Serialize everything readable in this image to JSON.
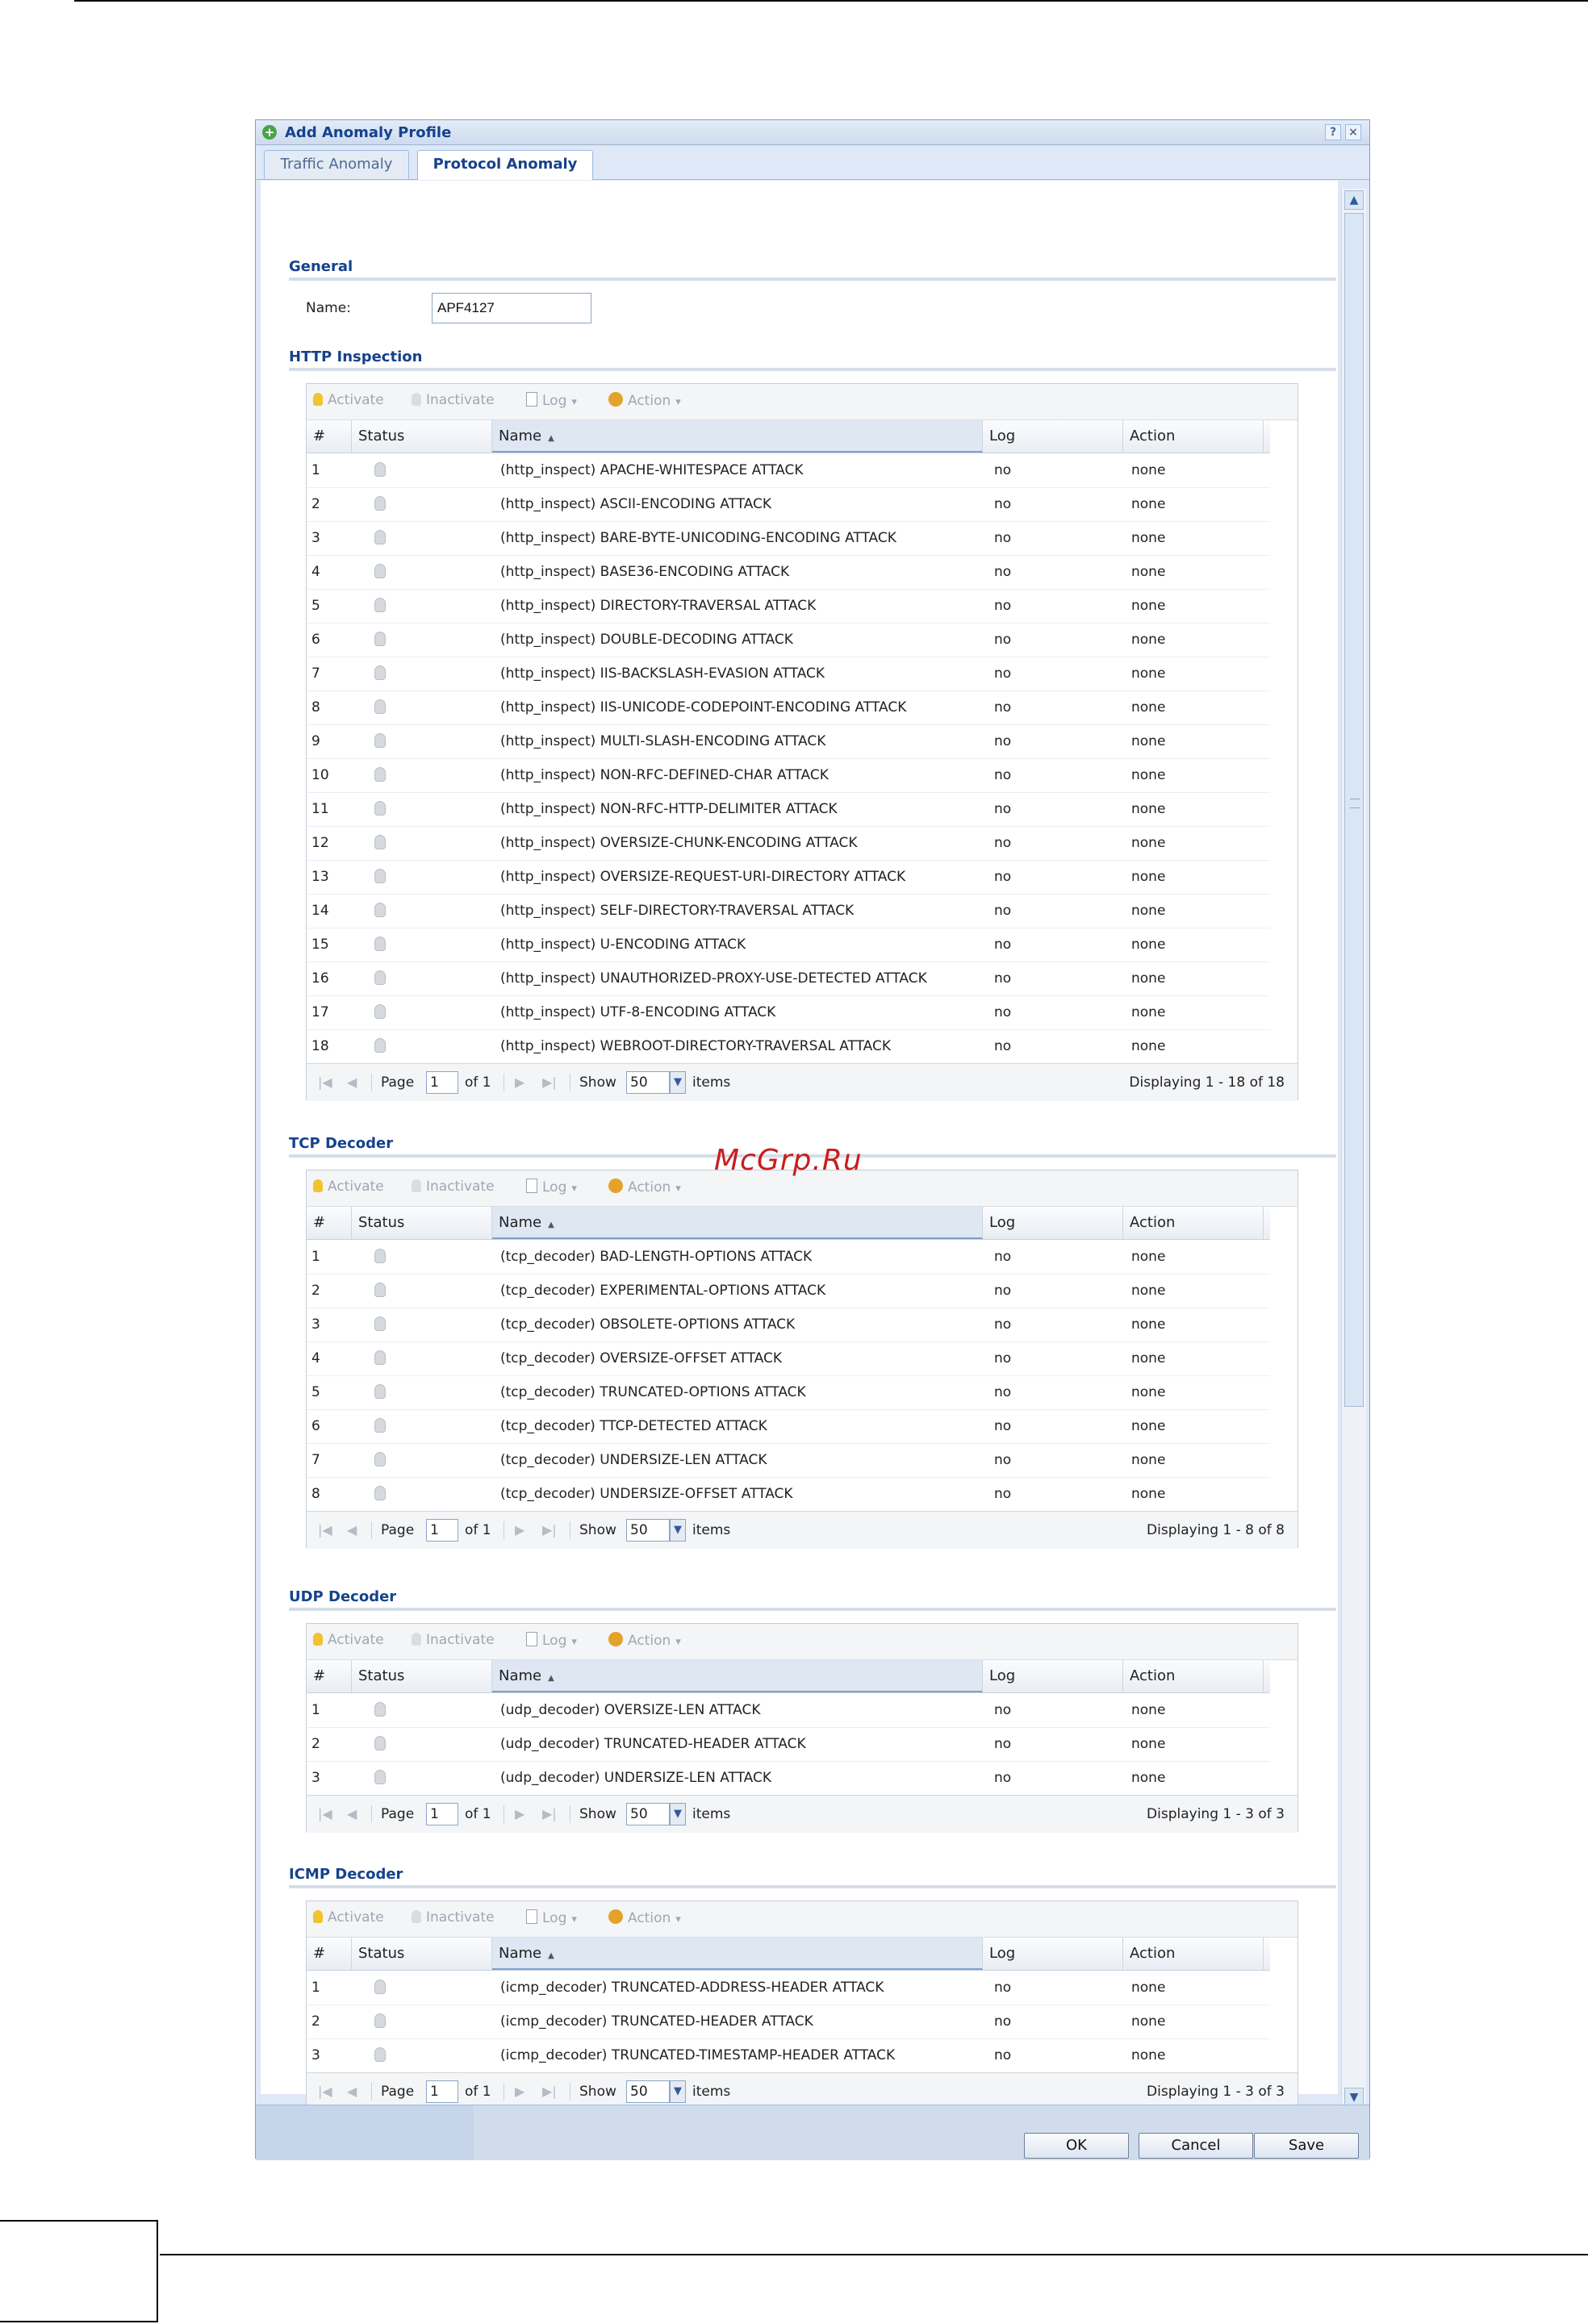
{
  "dialog": {
    "title": "Add Anomaly Profile",
    "help_label": "?",
    "close_label": "×",
    "tabs": [
      {
        "label": "Traffic Anomaly",
        "active": false
      },
      {
        "label": "Protocol Anomaly",
        "active": true
      }
    ],
    "general": {
      "title": "General",
      "name_label": "Name:",
      "name_value": "APF4127"
    },
    "toolbar": {
      "activate": "Activate",
      "inactivate": "Inactivate",
      "log": "Log",
      "action": "Action",
      "dropdown_glyph": "▾"
    },
    "columns": {
      "num": "#",
      "status": "Status",
      "name": "Name",
      "sort_glyph": "▲",
      "log": "Log",
      "action": "Action"
    },
    "pager": {
      "page_label": "Page",
      "page_value": "1",
      "of_label": "of 1",
      "show_label": "Show",
      "show_value": "50",
      "items_label": "items"
    },
    "sections": [
      {
        "title": "HTTP Inspection",
        "displaying": "Displaying 1 - 18 of 18",
        "rows": [
          {
            "num": "1",
            "name": "(http_inspect) APACHE-WHITESPACE ATTACK",
            "log": "no",
            "action": "none"
          },
          {
            "num": "2",
            "name": "(http_inspect) ASCII-ENCODING ATTACK",
            "log": "no",
            "action": "none"
          },
          {
            "num": "3",
            "name": "(http_inspect) BARE-BYTE-UNICODING-ENCODING ATTACK",
            "log": "no",
            "action": "none"
          },
          {
            "num": "4",
            "name": "(http_inspect) BASE36-ENCODING ATTACK",
            "log": "no",
            "action": "none"
          },
          {
            "num": "5",
            "name": "(http_inspect) DIRECTORY-TRAVERSAL ATTACK",
            "log": "no",
            "action": "none"
          },
          {
            "num": "6",
            "name": "(http_inspect) DOUBLE-DECODING ATTACK",
            "log": "no",
            "action": "none"
          },
          {
            "num": "7",
            "name": "(http_inspect) IIS-BACKSLASH-EVASION ATTACK",
            "log": "no",
            "action": "none"
          },
          {
            "num": "8",
            "name": "(http_inspect) IIS-UNICODE-CODEPOINT-ENCODING ATTACK",
            "log": "no",
            "action": "none"
          },
          {
            "num": "9",
            "name": "(http_inspect) MULTI-SLASH-ENCODING ATTACK",
            "log": "no",
            "action": "none"
          },
          {
            "num": "10",
            "name": "(http_inspect) NON-RFC-DEFINED-CHAR ATTACK",
            "log": "no",
            "action": "none"
          },
          {
            "num": "11",
            "name": "(http_inspect) NON-RFC-HTTP-DELIMITER ATTACK",
            "log": "no",
            "action": "none"
          },
          {
            "num": "12",
            "name": "(http_inspect) OVERSIZE-CHUNK-ENCODING ATTACK",
            "log": "no",
            "action": "none"
          },
          {
            "num": "13",
            "name": "(http_inspect) OVERSIZE-REQUEST-URI-DIRECTORY ATTACK",
            "log": "no",
            "action": "none"
          },
          {
            "num": "14",
            "name": "(http_inspect) SELF-DIRECTORY-TRAVERSAL ATTACK",
            "log": "no",
            "action": "none"
          },
          {
            "num": "15",
            "name": "(http_inspect) U-ENCODING ATTACK",
            "log": "no",
            "action": "none"
          },
          {
            "num": "16",
            "name": "(http_inspect) UNAUTHORIZED-PROXY-USE-DETECTED ATTACK",
            "log": "no",
            "action": "none"
          },
          {
            "num": "17",
            "name": "(http_inspect) UTF-8-ENCODING ATTACK",
            "log": "no",
            "action": "none"
          },
          {
            "num": "18",
            "name": "(http_inspect) WEBROOT-DIRECTORY-TRAVERSAL ATTACK",
            "log": "no",
            "action": "none"
          }
        ]
      },
      {
        "title": "TCP Decoder",
        "displaying": "Displaying 1 - 8 of 8",
        "rows": [
          {
            "num": "1",
            "name": "(tcp_decoder) BAD-LENGTH-OPTIONS ATTACK",
            "log": "no",
            "action": "none"
          },
          {
            "num": "2",
            "name": "(tcp_decoder) EXPERIMENTAL-OPTIONS ATTACK",
            "log": "no",
            "action": "none"
          },
          {
            "num": "3",
            "name": "(tcp_decoder) OBSOLETE-OPTIONS ATTACK",
            "log": "no",
            "action": "none"
          },
          {
            "num": "4",
            "name": "(tcp_decoder) OVERSIZE-OFFSET ATTACK",
            "log": "no",
            "action": "none"
          },
          {
            "num": "5",
            "name": "(tcp_decoder) TRUNCATED-OPTIONS ATTACK",
            "log": "no",
            "action": "none"
          },
          {
            "num": "6",
            "name": "(tcp_decoder) TTCP-DETECTED ATTACK",
            "log": "no",
            "action": "none"
          },
          {
            "num": "7",
            "name": "(tcp_decoder) UNDERSIZE-LEN ATTACK",
            "log": "no",
            "action": "none"
          },
          {
            "num": "8",
            "name": "(tcp_decoder) UNDERSIZE-OFFSET ATTACK",
            "log": "no",
            "action": "none"
          }
        ]
      },
      {
        "title": "UDP Decoder",
        "displaying": "Displaying 1 - 3 of 3",
        "rows": [
          {
            "num": "1",
            "name": "(udp_decoder) OVERSIZE-LEN ATTACK",
            "log": "no",
            "action": "none"
          },
          {
            "num": "2",
            "name": "(udp_decoder) TRUNCATED-HEADER ATTACK",
            "log": "no",
            "action": "none"
          },
          {
            "num": "3",
            "name": "(udp_decoder) UNDERSIZE-LEN ATTACK",
            "log": "no",
            "action": "none"
          }
        ]
      },
      {
        "title": "ICMP Decoder",
        "displaying": "Displaying 1 - 3 of 3",
        "rows": [
          {
            "num": "1",
            "name": "(icmp_decoder) TRUNCATED-ADDRESS-HEADER ATTACK",
            "log": "no",
            "action": "none"
          },
          {
            "num": "2",
            "name": "(icmp_decoder) TRUNCATED-HEADER ATTACK",
            "log": "no",
            "action": "none"
          },
          {
            "num": "3",
            "name": "(icmp_decoder) TRUNCATED-TIMESTAMP-HEADER ATTACK",
            "log": "no",
            "action": "none"
          }
        ]
      }
    ],
    "buttons": {
      "ok": "OK",
      "cancel": "Cancel",
      "save": "Save"
    }
  },
  "watermark": "McGrp.Ru"
}
